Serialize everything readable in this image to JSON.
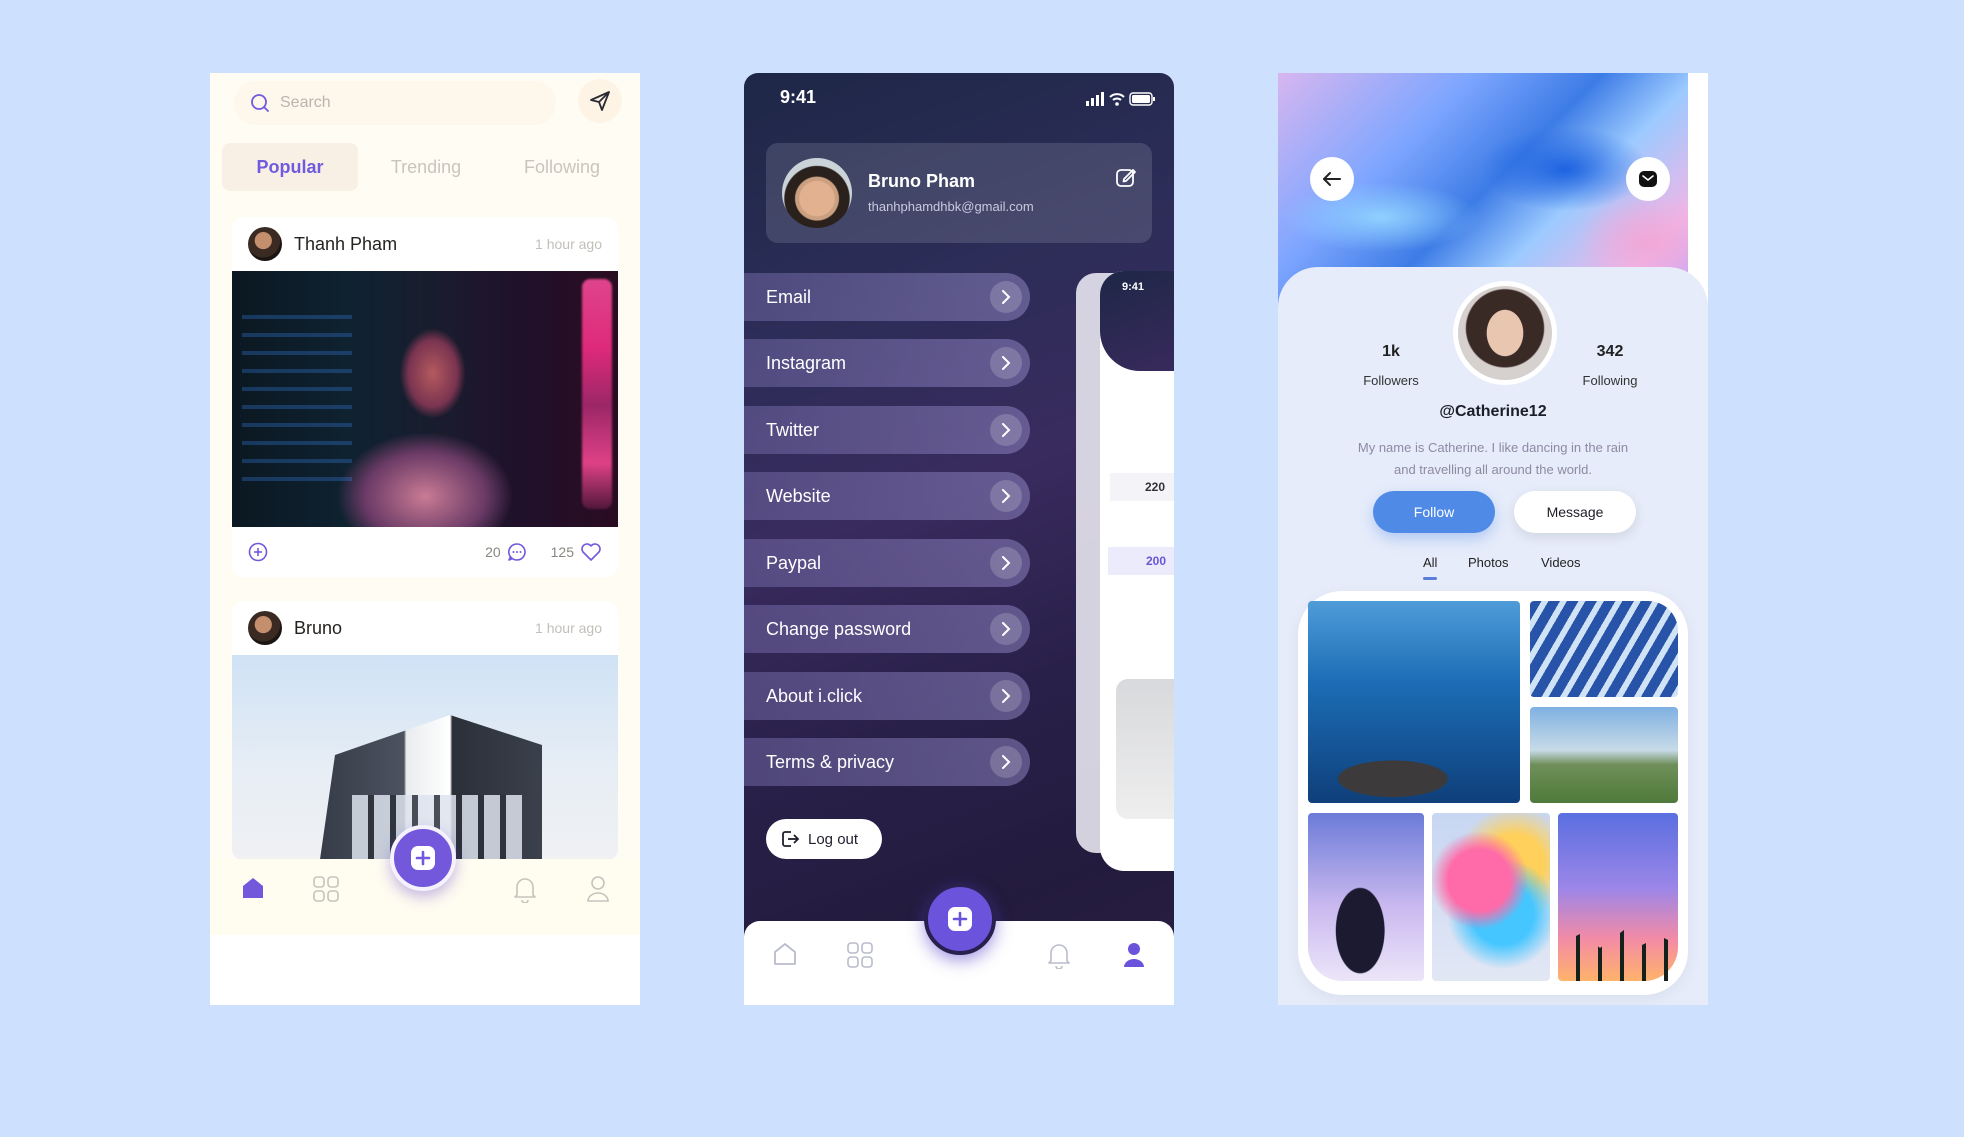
{
  "colors": {
    "background": "#cde0fd",
    "accent": "#7358dc",
    "follow_blue": "#4f8ae6"
  },
  "feed": {
    "search_placeholder": "Search",
    "tabs": [
      {
        "label": "Popular"
      },
      {
        "label": "Trending"
      },
      {
        "label": "Following"
      }
    ],
    "posts": [
      {
        "author": "Thanh Pham",
        "time": "1 hour ago",
        "comments": "20",
        "likes": "125"
      },
      {
        "author": "Bruno",
        "time": "1 hour ago"
      }
    ],
    "nav_icons": [
      "home-icon",
      "grid-icon",
      "bell-icon",
      "user-icon"
    ]
  },
  "settings": {
    "status_time": "9:41",
    "profile": {
      "name": "Bruno Pham",
      "email": "thanhphamdhbk@gmail.com"
    },
    "menu": [
      {
        "label": "Email"
      },
      {
        "label": "Instagram"
      },
      {
        "label": "Twitter"
      },
      {
        "label": "Website"
      },
      {
        "label": "Paypal"
      },
      {
        "label": "Change password"
      },
      {
        "label": "About i.click"
      },
      {
        "label": "Terms & privacy"
      }
    ],
    "logout_label": "Log out",
    "behind_screen": {
      "time": "9:41",
      "value1": "220",
      "value2": "200"
    }
  },
  "profile": {
    "followers_count": "1k",
    "followers_label": "Followers",
    "following_count": "342",
    "following_label": "Following",
    "handle": "@Catherine12",
    "bio": "My name is Catherine. I like dancing in the rain and travelling all around the world.",
    "follow_label": "Follow",
    "message_label": "Message",
    "tabs": [
      {
        "label": "All"
      },
      {
        "label": "Photos"
      },
      {
        "label": "Videos"
      }
    ]
  }
}
